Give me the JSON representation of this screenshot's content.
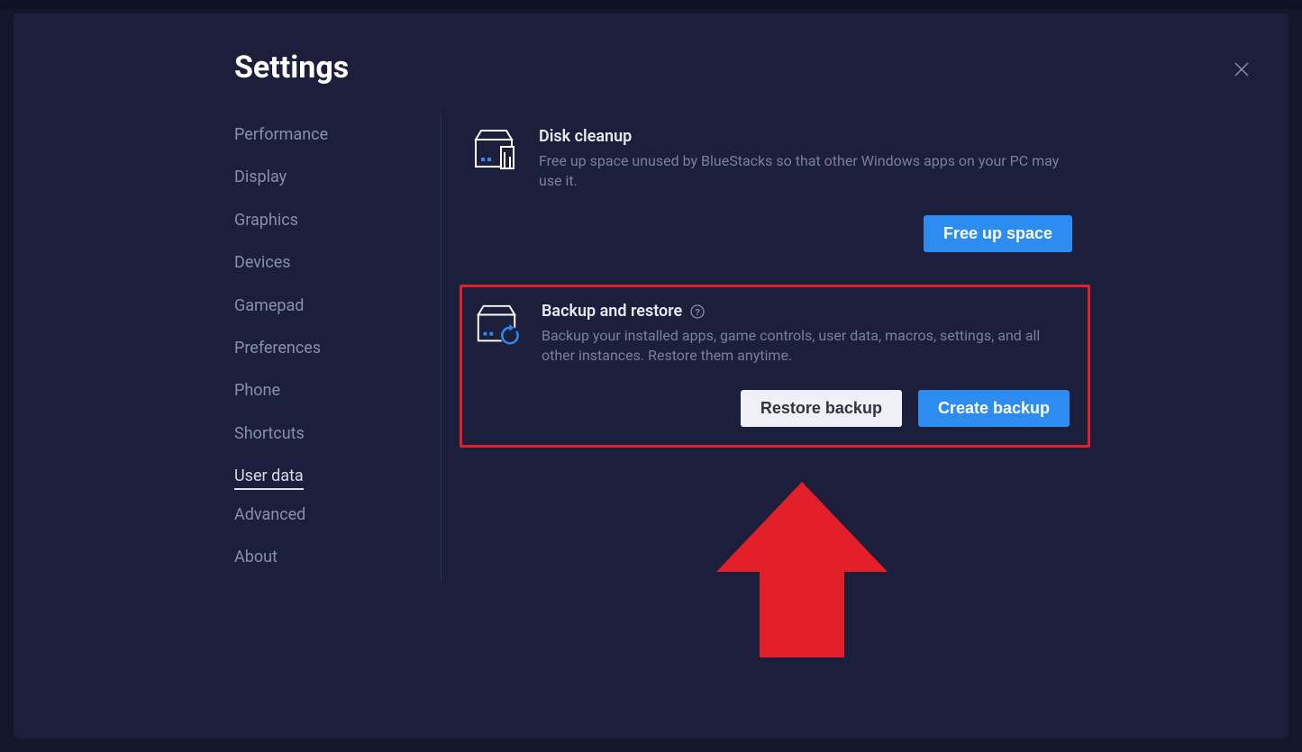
{
  "page_title": "Settings",
  "sidebar": {
    "items": [
      {
        "label": "Performance"
      },
      {
        "label": "Display"
      },
      {
        "label": "Graphics"
      },
      {
        "label": "Devices"
      },
      {
        "label": "Gamepad"
      },
      {
        "label": "Preferences"
      },
      {
        "label": "Phone"
      },
      {
        "label": "Shortcuts"
      },
      {
        "label": "User data"
      },
      {
        "label": "Advanced"
      },
      {
        "label": "About"
      }
    ],
    "active_index": 8
  },
  "main": {
    "disk_cleanup": {
      "title": "Disk cleanup",
      "desc": "Free up space unused by BlueStacks so that other Windows apps on your PC may use it.",
      "button": "Free up space"
    },
    "backup_restore": {
      "title": "Backup and restore",
      "desc": "Backup your installed apps, game controls, user data, macros, settings, and all other instances. Restore them anytime.",
      "restore_button": "Restore backup",
      "create_button": "Create backup"
    }
  },
  "colors": {
    "accent": "#2d8cf0",
    "highlight": "#e3202a"
  }
}
